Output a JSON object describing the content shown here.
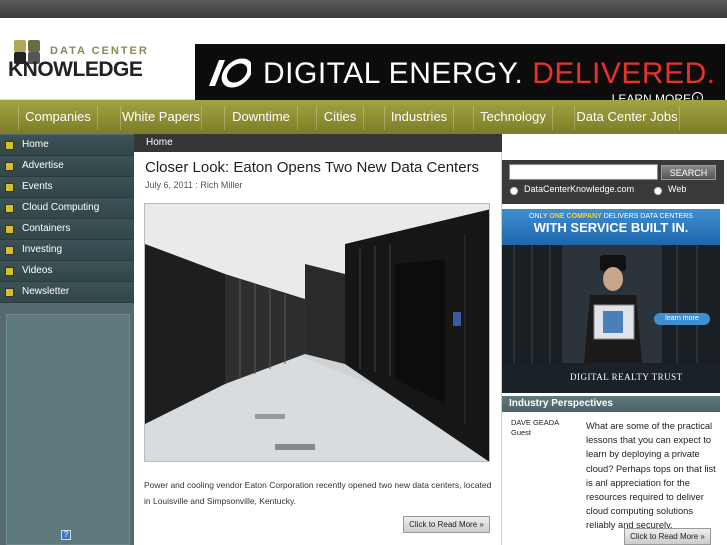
{
  "brand": {
    "line1": "DATA CENTER",
    "line2": "KNOWLEDGE"
  },
  "banner": {
    "prefix": "DIGITAL ENERGY. ",
    "highlight": "DELIVERED.",
    "cta": "LEARN MORE",
    "cta_icon": "circle-arrow"
  },
  "nav": {
    "items": [
      "Companies",
      "White Papers",
      "Downtime",
      "Cities",
      "Industries",
      "Technology",
      "Data Center Jobs"
    ]
  },
  "sidebar": {
    "items": [
      "Home",
      "Advertise",
      "Events",
      "Cloud Computing",
      "Containers",
      "Investing",
      "Videos",
      "Newsletter"
    ],
    "help_icon": "?"
  },
  "breadcrumb": "Home",
  "article": {
    "title": "Closer Look: Eaton Opens Two New Data Centers",
    "meta": "July 6, 2011 : Rich Miller",
    "excerpt": "Power and cooling vendor Eaton Corporation recently opened two new data centers, located in Louisville and Simpsonville, Kentucky.",
    "read_more": "Click to Read More »"
  },
  "search": {
    "button": "SEARCH",
    "options": [
      "DataCenterKnowledge.com",
      "Web"
    ],
    "value": ""
  },
  "side_ad": {
    "line1_pre": "ONLY ",
    "line1_hl": "ONE COMPANY",
    "line1_post": " DELIVERS DATA CENTERS",
    "line2": "WITH SERVICE BUILT IN.",
    "button": "learn more",
    "footer": "DIGITAL REALTY TRUST"
  },
  "perspectives": {
    "header": "Industry Perspectives",
    "author": "DAVE GEADA",
    "role": "Guest",
    "text": "What are some of the practical lessons that you can expect to learn by deploying a private cloud? Perhaps tops on that list is anl appreciation for the resources required to deliver cloud computing solutions reliably and securely.",
    "read_more": "Click to Read More »"
  },
  "colors": {
    "nav": "#8f9033",
    "sidebar": "#556b70",
    "accent_red": "#e8332a",
    "ad_blue": "#1e66ad"
  }
}
